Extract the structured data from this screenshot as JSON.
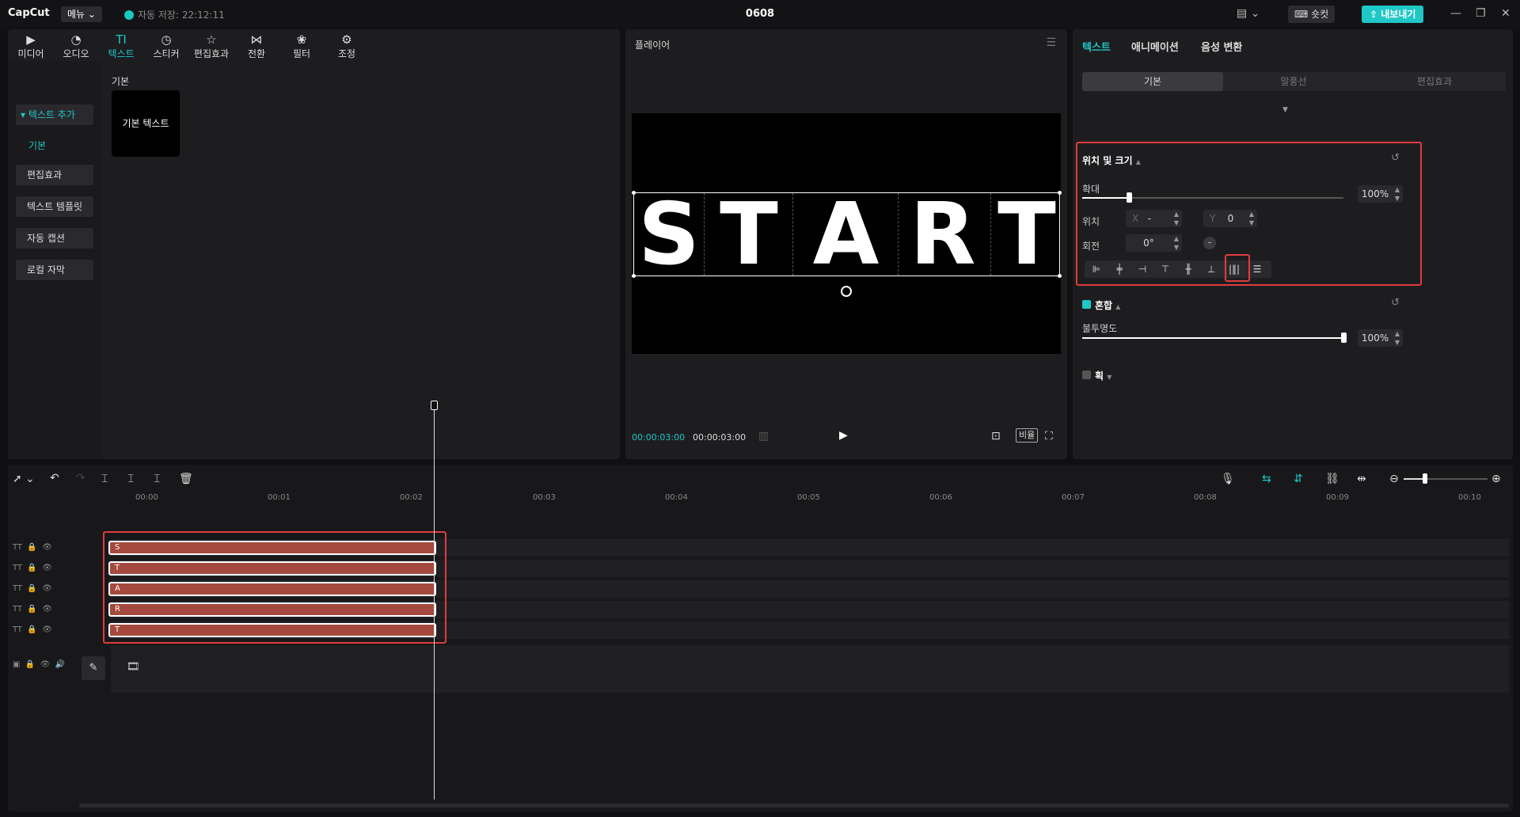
{
  "titlebar": {
    "logo": "CapCut",
    "menu_label": "메뉴",
    "autosave": "자동 저장: 22:12:11",
    "project_title": "0608",
    "shortcut_label": "숏컷",
    "export_label": "내보내기"
  },
  "toolbar": {
    "items": [
      {
        "label": "미디어",
        "icon": "media-icon"
      },
      {
        "label": "오디오",
        "icon": "audio-icon"
      },
      {
        "label": "텍스트",
        "icon": "text-icon"
      },
      {
        "label": "스티커",
        "icon": "sticker-icon"
      },
      {
        "label": "편집효과",
        "icon": "effects-icon"
      },
      {
        "label": "전환",
        "icon": "transition-icon"
      },
      {
        "label": "필터",
        "icon": "filter-icon"
      },
      {
        "label": "조정",
        "icon": "adjust-icon"
      }
    ],
    "active_index": 2
  },
  "sidebar": {
    "items": [
      "텍스트 추가",
      "기본",
      "편집효과",
      "텍스트 템플릿",
      "자동 캡션",
      "로컬 자막"
    ]
  },
  "library": {
    "section_label": "기본",
    "card_label": "기본 텍스트"
  },
  "player": {
    "title": "플레이어",
    "letters": [
      "S",
      "T",
      "A",
      "R",
      "T"
    ],
    "current_time": "00:00:03:00",
    "total_time": "00:00:03:00",
    "ratio_label": "비율"
  },
  "inspector": {
    "tabs": [
      "텍스트",
      "애니메이션",
      "음성 변환"
    ],
    "subtabs": [
      "기본",
      "말풍선",
      "편집효과"
    ],
    "transform": {
      "heading": "위치 및 크기",
      "scale_label": "확대",
      "scale_value": "100%",
      "scale_fraction": 0.18,
      "position_label": "위치",
      "x_label": "X",
      "x_value": "-",
      "y_label": "Y",
      "y_value": "0",
      "rotation_label": "회전",
      "rotation_value": "0°"
    },
    "blend": {
      "heading": "혼합",
      "opacity_label": "불투명도",
      "opacity_value": "100%",
      "opacity_fraction": 1.0
    },
    "stroke": {
      "heading": "획"
    }
  },
  "timeline": {
    "ruler": [
      "00:00",
      "00:01",
      "00:02",
      "00:03",
      "00:04",
      "00:05",
      "00:06",
      "00:07",
      "00:08",
      "00:09",
      "00:10"
    ],
    "clips": [
      "S",
      "T",
      "A",
      "R",
      "T"
    ]
  },
  "colors": {
    "accent": "#1fc7c7",
    "highlight_box": "#e03c3c",
    "clip": "#a5493f"
  }
}
